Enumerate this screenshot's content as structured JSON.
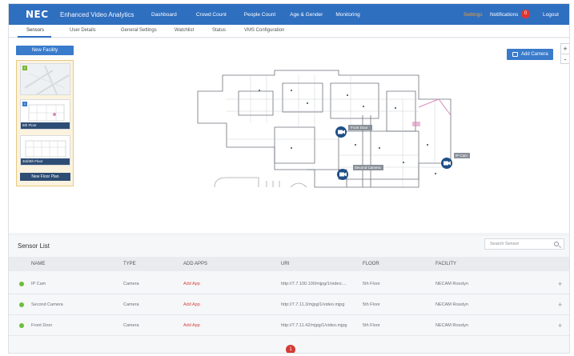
{
  "nav": {
    "brand": "NEC",
    "app_title": "Enhanced Video Analytics",
    "items": [
      "Dashboard",
      "Crowd Count",
      "People Count",
      "Age & Gender",
      "Monitoring"
    ],
    "settings": "Settings",
    "notifications": "Notifications",
    "notification_count": "0",
    "logout": "Logout",
    "accent": "#2f6fc0",
    "settings_color": "#f0a030"
  },
  "tabs": [
    "Sensors",
    "User Details",
    "General Settings",
    "Watchlist",
    "Status",
    "VMS Configuration"
  ],
  "active_tab": "Sensors",
  "map": {
    "new_facility": "New Facility",
    "add_camera": "Add Camera",
    "zoom_in": "+",
    "zoom_out": "-",
    "floors": [
      {
        "number": "2",
        "label": ""
      },
      {
        "number": "1",
        "label": "5th Floor"
      },
      {
        "number": "",
        "label": "3rd/4th Floor"
      }
    ],
    "new_floor_plan": "New Floor Plan",
    "camera_labels": [
      "Front Door",
      "Second Camera",
      "IP Cam"
    ]
  },
  "sensor_list": {
    "title": "Sensor List",
    "search_placeholder": "Search Sensor",
    "columns": [
      "NAME",
      "TYPE",
      "ADD APPS",
      "URI",
      "FLOOR",
      "FACILITY"
    ],
    "rows": [
      {
        "name": "IP Cam",
        "type": "Camera",
        "add_apps": "Add App",
        "uri": "http://7.7.100.100/mjpg/1/video....",
        "floor": "5th Floor",
        "facility": "NECAM Rosslyn",
        "status": "online"
      },
      {
        "name": "Second Camera",
        "type": "Camera",
        "add_apps": "Add App",
        "uri": "http://7.7.11.3/mjpg/1/video.mjpg",
        "floor": "5th Floor",
        "facility": "NECAM Rosslyn",
        "status": "online"
      },
      {
        "name": "Front Door",
        "type": "Camera",
        "add_apps": "Add App",
        "uri": "http://7.7.11.42/mjpg/1/video.mjpg",
        "floor": "5th Floor",
        "facility": "NECAM Rosslyn",
        "status": "online"
      }
    ],
    "row_action": "+",
    "page": "1",
    "status_color": "#6cbf3d",
    "add_app_color": "#d6453f"
  }
}
